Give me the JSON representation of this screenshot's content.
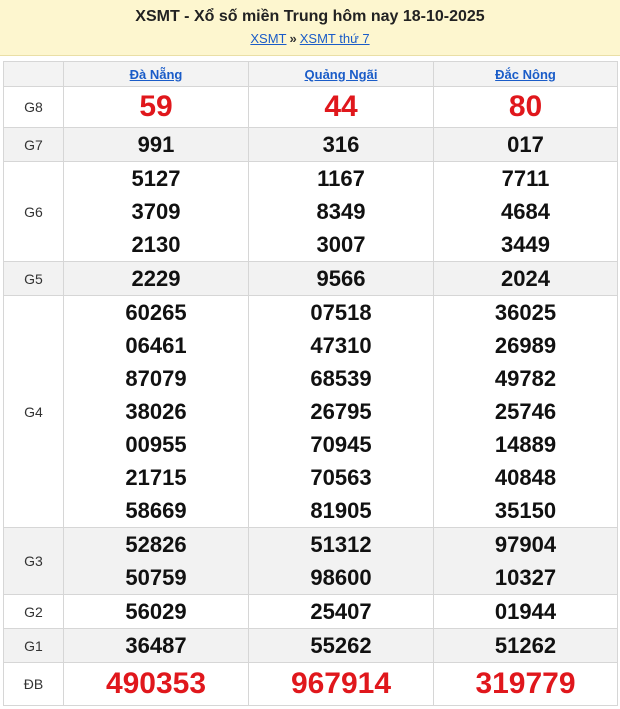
{
  "header": {
    "title": "XSMT - Xổ số miền Trung hôm nay 18-10-2025",
    "breadcrumb": [
      {
        "label": "XSMT"
      },
      {
        "label": "XSMT thứ 7"
      }
    ],
    "separator": "»"
  },
  "provinces": [
    "Đà Nẵng",
    "Quảng Ngãi",
    "Đắc Nông"
  ],
  "prizes": [
    {
      "label": "G8",
      "kind": "g8",
      "values": [
        [
          "59"
        ],
        [
          "44"
        ],
        [
          "80"
        ]
      ]
    },
    {
      "label": "G7",
      "kind": "normal",
      "values": [
        [
          "991"
        ],
        [
          "316"
        ],
        [
          "017"
        ]
      ]
    },
    {
      "label": "G6",
      "kind": "normal",
      "values": [
        [
          "5127",
          "3709",
          "2130"
        ],
        [
          "1167",
          "8349",
          "3007"
        ],
        [
          "7711",
          "4684",
          "3449"
        ]
      ]
    },
    {
      "label": "G5",
      "kind": "normal",
      "values": [
        [
          "2229"
        ],
        [
          "9566"
        ],
        [
          "2024"
        ]
      ]
    },
    {
      "label": "G4",
      "kind": "normal",
      "values": [
        [
          "60265",
          "06461",
          "87079",
          "38026",
          "00955",
          "21715",
          "58669"
        ],
        [
          "07518",
          "47310",
          "68539",
          "26795",
          "70945",
          "70563",
          "81905"
        ],
        [
          "36025",
          "26989",
          "49782",
          "25746",
          "14889",
          "40848",
          "35150"
        ]
      ]
    },
    {
      "label": "G3",
      "kind": "normal",
      "values": [
        [
          "52826",
          "50759"
        ],
        [
          "51312",
          "98600"
        ],
        [
          "97904",
          "10327"
        ]
      ]
    },
    {
      "label": "G2",
      "kind": "normal",
      "values": [
        [
          "56029"
        ],
        [
          "25407"
        ],
        [
          "01944"
        ]
      ]
    },
    {
      "label": "G1",
      "kind": "normal",
      "values": [
        [
          "36487"
        ],
        [
          "55262"
        ],
        [
          "51262"
        ]
      ]
    },
    {
      "label": "ĐB",
      "kind": "db",
      "values": [
        [
          "490353"
        ],
        [
          "967914"
        ],
        [
          "319779"
        ]
      ]
    }
  ],
  "colors": {
    "prize_red": "#e0171c",
    "link_blue": "#1a5cc8",
    "header_bg": "#fdf6cf",
    "alt_row": "#f2f2f2"
  }
}
